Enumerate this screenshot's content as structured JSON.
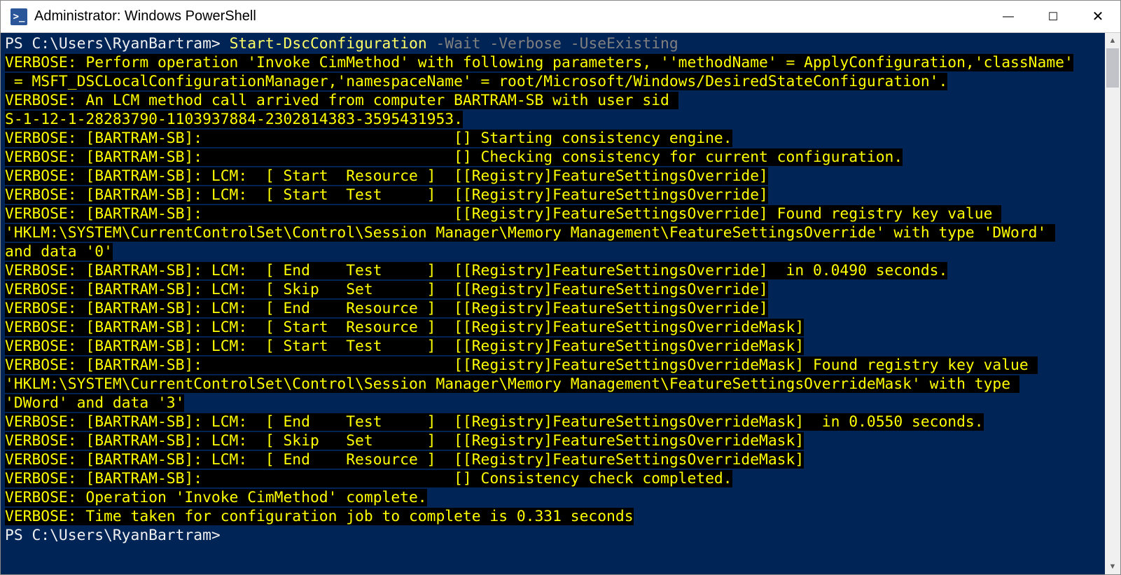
{
  "window": {
    "icon_glyph": ">_",
    "title": "Administrator: Windows PowerShell",
    "buttons": {
      "minimize": "—",
      "maximize": "☐",
      "close": "✕"
    }
  },
  "prompt": {
    "ps": "PS ",
    "path": "C:\\Users\\RyanBartram",
    "gt": "> "
  },
  "cmd": {
    "name": "Start-DscConfiguration",
    "args": " -Wait -Verbose -UseExisting"
  },
  "output": [
    "VERBOSE: Perform operation 'Invoke CimMethod' with following parameters, ''methodName' = ApplyConfiguration,'className'",
    " = MSFT_DSCLocalConfigurationManager,'namespaceName' = root/Microsoft/Windows/DesiredStateConfiguration'.",
    "VERBOSE: An LCM method call arrived from computer BARTRAM-SB with user sid ",
    "S-1-12-1-28283790-1103937884-2302814383-3595431953.",
    "VERBOSE: [BARTRAM-SB]:                            [] Starting consistency engine.",
    "VERBOSE: [BARTRAM-SB]:                            [] Checking consistency for current configuration.",
    "VERBOSE: [BARTRAM-SB]: LCM:  [ Start  Resource ]  [[Registry]FeatureSettingsOverride]",
    "VERBOSE: [BARTRAM-SB]: LCM:  [ Start  Test     ]  [[Registry]FeatureSettingsOverride]",
    "VERBOSE: [BARTRAM-SB]:                            [[Registry]FeatureSettingsOverride] Found registry key value ",
    "'HKLM:\\SYSTEM\\CurrentControlSet\\Control\\Session Manager\\Memory Management\\FeatureSettingsOverride' with type 'DWord' ",
    "and data '0'",
    "VERBOSE: [BARTRAM-SB]: LCM:  [ End    Test     ]  [[Registry]FeatureSettingsOverride]  in 0.0490 seconds.",
    "VERBOSE: [BARTRAM-SB]: LCM:  [ Skip   Set      ]  [[Registry]FeatureSettingsOverride]",
    "VERBOSE: [BARTRAM-SB]: LCM:  [ End    Resource ]  [[Registry]FeatureSettingsOverride]",
    "VERBOSE: [BARTRAM-SB]: LCM:  [ Start  Resource ]  [[Registry]FeatureSettingsOverrideMask]",
    "VERBOSE: [BARTRAM-SB]: LCM:  [ Start  Test     ]  [[Registry]FeatureSettingsOverrideMask]",
    "VERBOSE: [BARTRAM-SB]:                            [[Registry]FeatureSettingsOverrideMask] Found registry key value ",
    "'HKLM:\\SYSTEM\\CurrentControlSet\\Control\\Session Manager\\Memory Management\\FeatureSettingsOverrideMask' with type ",
    "'DWord' and data '3'",
    "VERBOSE: [BARTRAM-SB]: LCM:  [ End    Test     ]  [[Registry]FeatureSettingsOverrideMask]  in 0.0550 seconds.",
    "VERBOSE: [BARTRAM-SB]: LCM:  [ Skip   Set      ]  [[Registry]FeatureSettingsOverrideMask]",
    "VERBOSE: [BARTRAM-SB]: LCM:  [ End    Resource ]  [[Registry]FeatureSettingsOverrideMask]",
    "VERBOSE: [BARTRAM-SB]:                            [] Consistency check completed.",
    "VERBOSE: Operation 'Invoke CimMethod' complete.",
    "VERBOSE: Time taken for configuration job to complete is 0.331 seconds"
  ],
  "prompt2": {
    "ps": "PS ",
    "path": "C:\\Users\\RyanBartram",
    "gt": "> "
  }
}
